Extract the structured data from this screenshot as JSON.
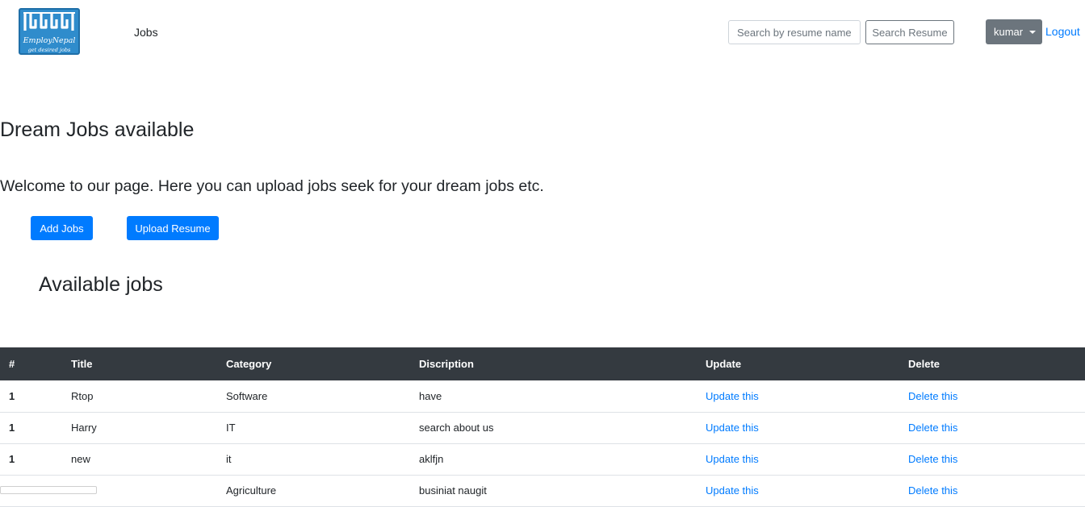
{
  "brand": {
    "name": "EmployNepal",
    "tagline": "get desired jobs",
    "logo_color": "#2f8ccc"
  },
  "nav": {
    "jobs_link": "Jobs",
    "search_placeholder": "Search by resume name",
    "search_button": "Search Resume",
    "user_name": "kumar",
    "logout": "Logout"
  },
  "hero": {
    "title": "Dream Jobs available",
    "text": "Welcome to our page. Here you can upload jobs seek for your dream jobs etc.",
    "add_jobs_button": "Add Jobs",
    "upload_resume_button": "Upload Resume"
  },
  "section": {
    "title": "Available jobs"
  },
  "table": {
    "headers": [
      "#",
      "Title",
      "Category",
      "Discription",
      "Update",
      "Delete"
    ],
    "rows": [
      {
        "num": "1",
        "title": "Rtop",
        "category": "Software",
        "description": "have",
        "update": "Update this",
        "delete": "Delete this"
      },
      {
        "num": "1",
        "title": "Harry",
        "category": "IT",
        "description": "search about us",
        "update": "Update this",
        "delete": "Delete this"
      },
      {
        "num": "1",
        "title": "new",
        "category": "it",
        "description": "aklfjn",
        "update": "Update this",
        "delete": "Delete this"
      },
      {
        "num": "1",
        "title": "",
        "category": "Agriculture",
        "description": "businiat naugit",
        "update": "Update this",
        "delete": "Delete this"
      }
    ]
  },
  "colors": {
    "primary": "#007bff",
    "secondary": "#6c757d",
    "table_header": "#343a40"
  }
}
